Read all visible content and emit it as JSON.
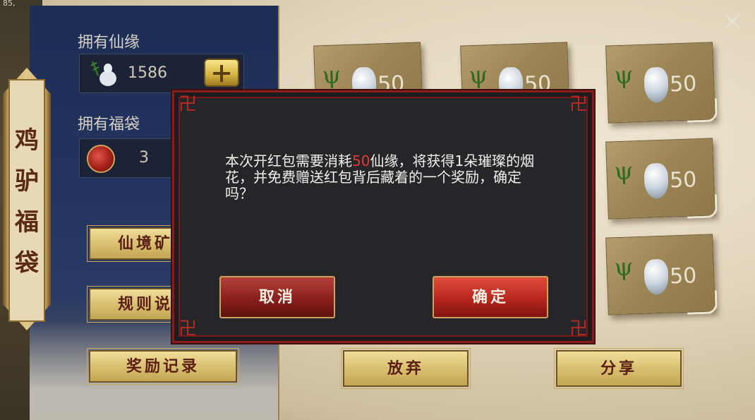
{
  "topbar": {
    "partial_text": "85,"
  },
  "left_panel": {
    "xianyuan": {
      "label": "拥有仙缘",
      "value": "1586",
      "icon": "gourd-vase-icon",
      "add_icon": "plus-icon"
    },
    "fudai": {
      "label": "拥有福袋",
      "value": "3",
      "icon": "red-lucky-bag-icon"
    },
    "banner_title": "鸡驴福袋",
    "buttons": {
      "btn1_visible_label": "仙境矿",
      "btn2_visible_label": "规则说",
      "rewards_record": "奖励记录"
    }
  },
  "cards": [
    {
      "cost": "50"
    },
    {
      "cost": "50"
    },
    {
      "cost": "50"
    },
    {
      "cost": "50"
    },
    {
      "cost": "50"
    }
  ],
  "bottom_buttons": {
    "give_up": "放弃",
    "share": "分享"
  },
  "close_icon": "×",
  "dialog": {
    "message_before": "本次开红包需要消耗",
    "message_highlight": "50",
    "message_after": "仙缘，将获得1朵璀璨的烟花，并免费赠送红包背后藏着的一个奖励，确定吗？",
    "cancel_label": "取消",
    "confirm_label": "确定",
    "corner_glyph": "卍",
    "accent_color": "#e23a2c"
  }
}
